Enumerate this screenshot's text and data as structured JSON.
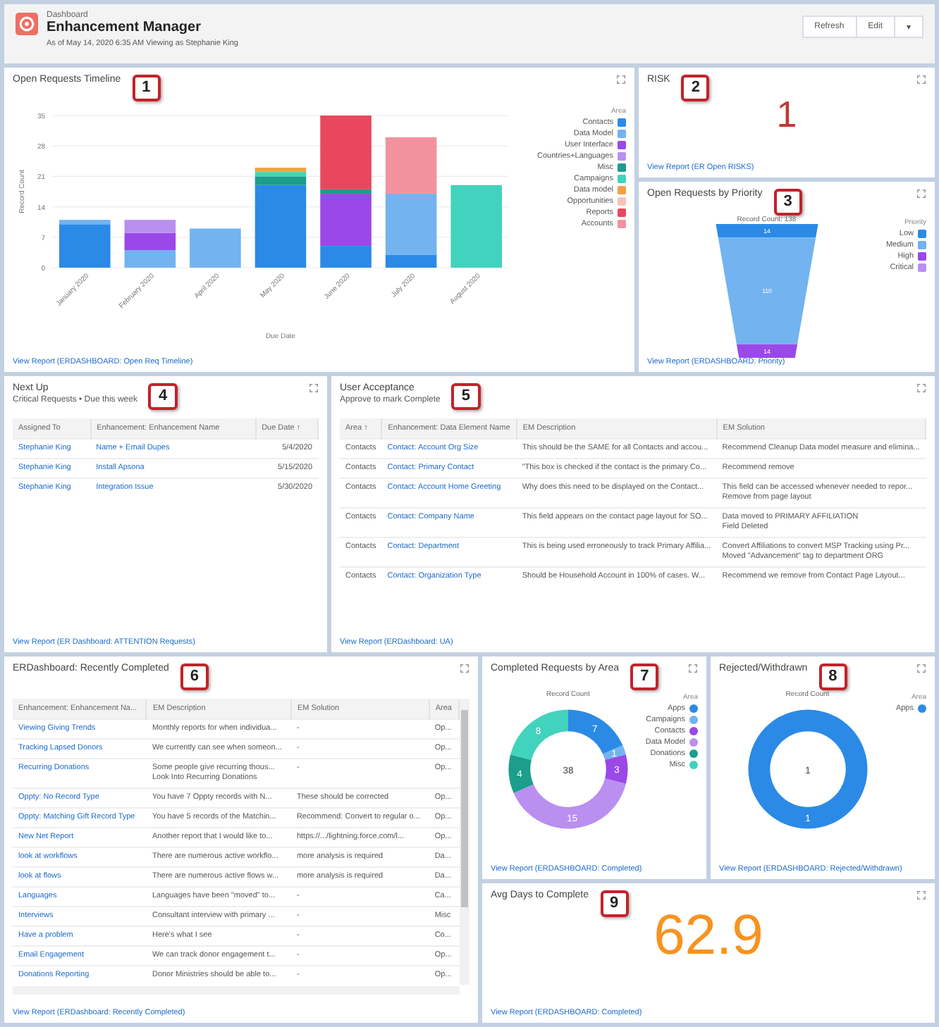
{
  "header": {
    "breadcrumb": "Dashboard",
    "title": "Enhancement Manager",
    "subtitle": "As of May 14, 2020 6:35 AM Viewing as Stephanie King",
    "buttons": [
      "Refresh",
      "Edit"
    ],
    "menu_glyph": "▾"
  },
  "timeline": {
    "title": "Open Requests Timeline",
    "callout": "1",
    "legend_title": "Area",
    "link": "View Report (ERDASHBOARD: Open Req Timeline)",
    "chart_data": {
      "type": "bar",
      "stacked": true,
      "grid": true,
      "xlabel": "Due Date",
      "ylabel": "Record Count",
      "categories": [
        "January 2020",
        "February 2020",
        "April 2020",
        "May 2020",
        "June 2020",
        "July 2020",
        "August 2020"
      ],
      "ylim": [
        0,
        35
      ],
      "yticks": [
        0,
        7,
        14,
        21,
        28,
        35
      ],
      "series": [
        {
          "name": "Contacts",
          "color": "#2b8ae6",
          "values": [
            10,
            0,
            0,
            19,
            5,
            3,
            0
          ]
        },
        {
          "name": "Data Model",
          "color": "#72b3f0",
          "values": [
            1,
            4,
            9,
            0,
            0,
            14,
            0
          ]
        },
        {
          "name": "User Interface",
          "color": "#9a48e8",
          "values": [
            0,
            4,
            0,
            0,
            12,
            0,
            0
          ]
        },
        {
          "name": "Countries+Languages",
          "color": "#b98ff0",
          "values": [
            0,
            3,
            0,
            0,
            0,
            0,
            0
          ]
        },
        {
          "name": "Misc",
          "color": "#1b9e8c",
          "values": [
            0,
            0,
            0,
            2,
            1,
            0,
            0
          ]
        },
        {
          "name": "Campaigns",
          "color": "#41d3bd",
          "values": [
            0,
            0,
            0,
            1,
            0,
            0,
            19
          ]
        },
        {
          "name": "Data model",
          "color": "#f4a146",
          "values": [
            0,
            0,
            0,
            1,
            0,
            0,
            0
          ]
        },
        {
          "name": "Opportunities",
          "color": "#f7c2b8",
          "values": [
            0,
            0,
            0,
            0,
            0,
            0,
            0
          ]
        },
        {
          "name": "Reports",
          "color": "#e9475e",
          "values": [
            0,
            0,
            0,
            0,
            17,
            0,
            0
          ]
        },
        {
          "name": "Accounts",
          "color": "#f3929f",
          "values": [
            0,
            0,
            0,
            0,
            0,
            13,
            0
          ]
        }
      ]
    }
  },
  "risk": {
    "title": "RISK",
    "callout": "2",
    "value": "1",
    "link": "View Report (ER Open RISKS)"
  },
  "priority": {
    "title": "Open Requests by Priority",
    "callout": "3",
    "caption": "Record Count: 138",
    "legend_title": "Priority",
    "link": "View Report (ERDASHBOARD: Priority)",
    "legend": [
      {
        "label": "Low",
        "color": "#2b8ae6"
      },
      {
        "label": "Medium",
        "color": "#72b3f0"
      },
      {
        "label": "High",
        "color": "#9a48e8"
      },
      {
        "label": "Critical",
        "color": "#b98ff0"
      }
    ],
    "segments": [
      {
        "value": "14",
        "color": "#2b8ae6"
      },
      {
        "value": "110",
        "color": "#72b3f0"
      },
      {
        "value": "14",
        "color": "#9a48e8"
      }
    ]
  },
  "next_up": {
    "title": "Next Up",
    "subtitle": "Critical Requests • Due this week",
    "callout": "4",
    "link": "View Report (ER Dashboard: ATTENTION Requests)",
    "columns": [
      {
        "label": "Assigned To",
        "kind": "link"
      },
      {
        "label": "Enhancement: Enhancement Name",
        "kind": "link"
      },
      {
        "label": "Due Date ↑",
        "kind": "date"
      }
    ],
    "rows": [
      [
        "Stephanie King",
        "Name + Email Dupes",
        "5/4/2020"
      ],
      [
        "Stephanie King",
        "Install Apsona",
        "5/15/2020"
      ],
      [
        "Stephanie King",
        "Integration Issue",
        "5/30/2020"
      ]
    ]
  },
  "user_acceptance": {
    "title": "User Acceptance",
    "subtitle": "Approve to mark Complete",
    "callout": "5",
    "link": "View Report (ERDashboard: UA)",
    "columns": [
      {
        "label": "Area ↑",
        "kind": "text"
      },
      {
        "label": "Enhancement: Data Element Name",
        "kind": "link"
      },
      {
        "label": "EM Description",
        "kind": "text"
      },
      {
        "label": "EM Solution",
        "kind": "text"
      }
    ],
    "rows": [
      [
        "Contacts",
        "Contact: Account Org Size",
        "This should be the SAME for all Contacts and accou...",
        "Recommend Cleanup Data model measure and elimina..."
      ],
      [
        "Contacts",
        "Contact: Primary Contact",
        "\"This box is checked if the contact is the primary Co...",
        "Recommend remove"
      ],
      [
        "Contacts",
        "Contact: Account Home Greeting",
        "Why does this need to be displayed on the Contact...",
        "This field can be accessed whenever needed to repor...\nRemove from page layout"
      ],
      [
        "Contacts",
        "Contact: Company Name",
        "This field appears on the contact page layout for SO...",
        "Data moved to PRIMARY AFFILIATION\nField Deleted"
      ],
      [
        "Contacts",
        "Contact: Department",
        "This is being used erroneously to track Primary Affilia...",
        "Convert Affiliations to convert MSP Tracking using Pr...\nMoved \"Advancement\" tag to department ORG"
      ],
      [
        "Contacts",
        "Contact: Organization Type",
        "Should be Household Account in 100% of cases. W...",
        "Recommend we remove from Contact Page Layout..."
      ]
    ]
  },
  "recent": {
    "title": "ERDashboard: Recently Completed",
    "callout": "6",
    "link": "View Report (ERDashboard: Recently Completed)",
    "columns": [
      {
        "label": "Enhancement: Enhancement Na...",
        "kind": "link"
      },
      {
        "label": "EM Description",
        "kind": "text"
      },
      {
        "label": "EM Solution",
        "kind": "text"
      },
      {
        "label": "Area",
        "kind": "text"
      }
    ],
    "rows": [
      [
        "Viewing Giving Trends",
        "Monthly reports for when individua...",
        "-",
        "Op..."
      ],
      [
        "Tracking Lapsed Donors",
        "We currently can see when someon...",
        "-",
        "Op..."
      ],
      [
        "Recurring Donations",
        "Some people give recurring thous...\nLook Into Recurring Donations",
        "-",
        "Op..."
      ],
      [
        "Oppty: No Record Type",
        "You have 7 Oppty records with N...",
        "These should be corrected",
        "Op..."
      ],
      [
        "Oppty: Matching Gift Record Type",
        "You have 5 records of the Matchin...",
        "Recommend: Convert to regular o...",
        "Op..."
      ],
      [
        "New Net Report",
        "Another report that I would like to...",
        "https://.../lightning.force.com/l...",
        "Op..."
      ],
      [
        "look at workflows",
        "There are numerous active workflo...",
        "more analysis is required",
        "Da..."
      ],
      [
        "look at flows",
        "There are numerous active flows w...",
        "more analysis is required",
        "Da..."
      ],
      [
        "Languages",
        "Languages have been \"moved\" to...",
        "-",
        "Ca..."
      ],
      [
        "Interviews",
        "Consultant interview with primary ...",
        "-",
        "Misc"
      ],
      [
        "Have a problem",
        "Here's what I see",
        "-",
        "Co..."
      ],
      [
        "Email Engagement",
        "We can track donor engagement t...",
        "-",
        "Op..."
      ],
      [
        "Donations Reporting",
        "Donor Ministries should be able to...",
        "-",
        "Op..."
      ]
    ]
  },
  "by_area": {
    "title": "Completed Requests by Area",
    "callout": "7",
    "caption": "Record Count",
    "center": "38",
    "legend_title": "Area",
    "link": "View Report (ERDASHBOARD: Completed)",
    "legend": [
      {
        "color": "#2b8ae6"
      },
      {
        "color": "#72b3f0"
      },
      {
        "color": "#9a48e8"
      },
      {
        "color": "#b98ff0"
      },
      {
        "color": "#1b9e8c"
      },
      {
        "color": "#41d3bd"
      }
    ],
    "chart_data": {
      "type": "donut",
      "categories": [
        "Apps",
        "Campaigns",
        "Contacts",
        "Data Model",
        "Donations",
        "Misc"
      ],
      "values": [
        7,
        1,
        3,
        15,
        4,
        8
      ],
      "value_labels": [
        "7",
        "1",
        "3",
        "15",
        "4",
        "8"
      ]
    }
  },
  "rejected": {
    "title": "Rejected/Withdrawn",
    "callout": "8",
    "caption": "Record Count",
    "center": "1",
    "legend_title": "Area",
    "link": "View Report (ERDASHBOARD: Rejected/Withdrawn)",
    "ring_label": "1",
    "legend": [
      {
        "label": "Apps",
        "color": "#2b8ae6"
      }
    ]
  },
  "avg_days": {
    "title": "Avg Days to Complete",
    "callout": "9",
    "value": "62.9",
    "link": "View Report (ERDASHBOARD: Completed)"
  }
}
